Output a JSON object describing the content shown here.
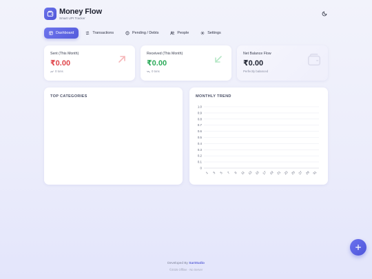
{
  "app": {
    "title": "Money Flow",
    "subtitle": "Smart UPI Tracker"
  },
  "nav": [
    {
      "label": "Dashboard",
      "icon": "dashboard-icon",
      "active": true
    },
    {
      "label": "Transactions",
      "icon": "arrows-icon",
      "active": false
    },
    {
      "label": "Pending / Debts",
      "icon": "clock-icon",
      "active": false
    },
    {
      "label": "People",
      "icon": "people-icon",
      "active": false
    },
    {
      "label": "Settings",
      "icon": "gear-icon",
      "active": false
    }
  ],
  "stats": {
    "sent": {
      "label": "Sent (This Month)",
      "value": "₹0.00",
      "meta": "0 txns",
      "color": "#e0474c"
    },
    "received": {
      "label": "Received (This Month)",
      "value": "₹0.00",
      "meta": "0 txns",
      "color": "#2cab5a"
    },
    "balance": {
      "label": "Net Balance Flow",
      "value": "₹0.00",
      "meta": "Perfectly balanced",
      "color": "#1e2230"
    }
  },
  "panels": {
    "categories_title": "TOP CATEGORIES",
    "trend_title": "MONTHLY TREND"
  },
  "chart_data": {
    "type": "line",
    "title": "MONTHLY TREND",
    "xlabel": "",
    "ylabel": "",
    "x": [
      "1",
      "3",
      "5",
      "7",
      "9",
      "11",
      "13",
      "15",
      "17",
      "19",
      "21",
      "23",
      "25",
      "27",
      "29",
      "31"
    ],
    "y_ticks": [
      "0",
      "0.1",
      "0.2",
      "0.3",
      "0.4",
      "0.5",
      "0.6",
      "0.7",
      "0.8",
      "0.9",
      "1.0"
    ],
    "ylim": [
      0,
      1.0
    ],
    "series": [],
    "grid": true
  },
  "footer": {
    "prefix": "Developed By ",
    "brand": "SarStudio",
    "line2": "©2025 Offline · No Server"
  },
  "colors": {
    "accent": "#555cdc",
    "sent": "#e0474c",
    "received": "#2cab5a"
  }
}
